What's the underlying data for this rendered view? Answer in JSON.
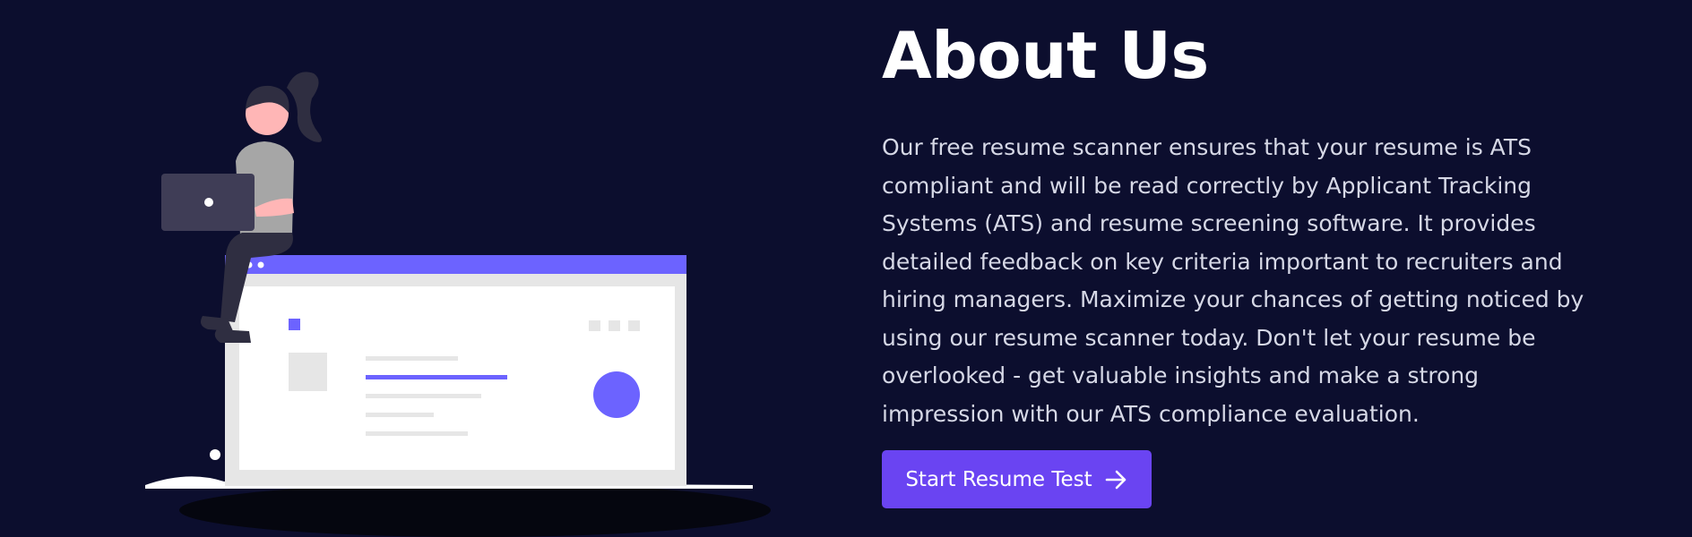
{
  "about": {
    "title": "About Us",
    "body": "Our free resume scanner ensures that your resume is ATS compliant and will be read correctly by Applicant Tracking Systems (ATS) and resume screening software. It provides detailed feedback on key criteria important to recruiters and hiring managers. Maximize your chances of getting noticed by using our resume scanner today. Don't let your resume be overlooked - get valuable insights and make a strong impression with our ATS compliance evaluation.",
    "cta_label": "Start Resume Test",
    "cta_icon": "arrow-right-icon"
  },
  "colors": {
    "background": "#0c0e2e",
    "accent": "#6a44f2",
    "illustration_accent": "#6c63ff",
    "text": "#d6d8e6"
  }
}
